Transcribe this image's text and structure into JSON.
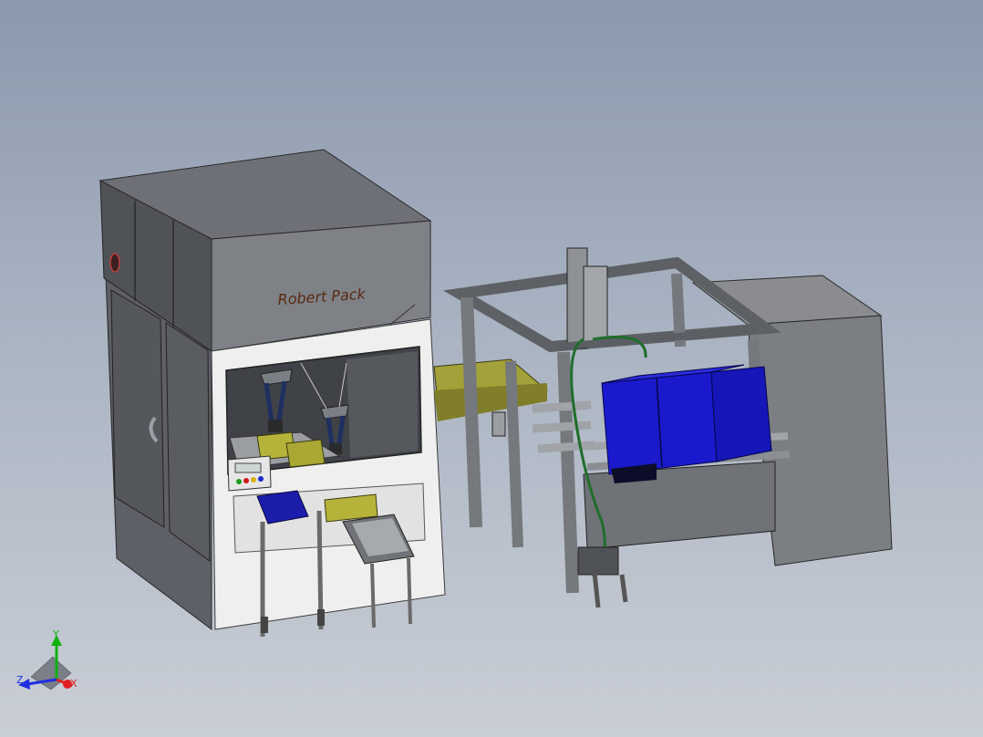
{
  "model": {
    "brand_label": "Robert Pack",
    "colors": {
      "background_top": "#8b99ad",
      "background_bottom": "#c9ced6",
      "machine_dark": "#6a6d72",
      "frame_grey": "#8d8f92",
      "panel_white": "#f1f1f1",
      "box_yellow": "#b5b33a",
      "case_blue": "#1a1acc",
      "belt_blue": "#1c1caa",
      "hose_green": "#1e6e2a"
    }
  },
  "triad": {
    "x_label": "X",
    "y_label": "Y",
    "z_label": "Z",
    "x_color": "#e02020",
    "y_color": "#10b010",
    "z_color": "#2030e0"
  }
}
